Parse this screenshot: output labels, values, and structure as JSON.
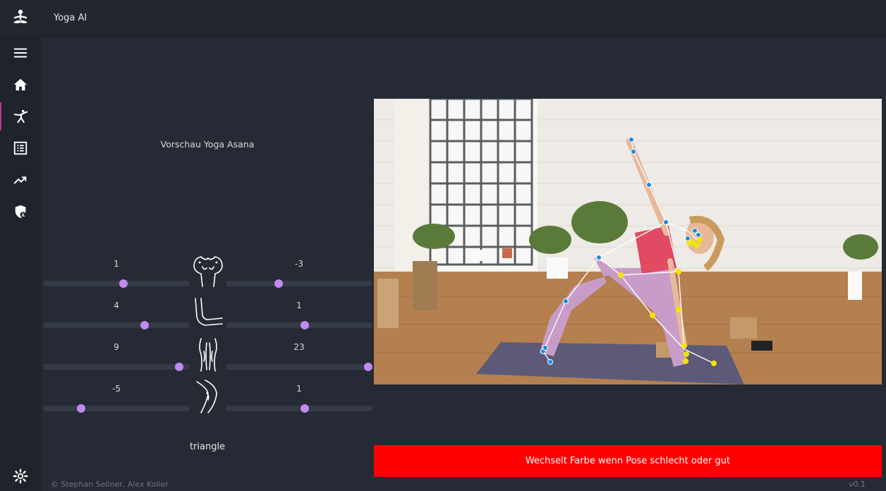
{
  "app": {
    "title": "Yoga AI"
  },
  "sidebar": {
    "items": [
      {
        "icon": "menu-icon"
      },
      {
        "icon": "home-icon"
      },
      {
        "icon": "yoga-pose-icon",
        "active": true
      },
      {
        "icon": "list-icon"
      },
      {
        "icon": "trending-up-icon"
      },
      {
        "icon": "shield-user-icon"
      },
      {
        "icon": "gear-icon"
      }
    ]
  },
  "preview": {
    "label": "Vorschau Yoga Asana",
    "pose_name": "triangle"
  },
  "sliders": {
    "row1": {
      "left_value": "1",
      "right_value": "-3",
      "left_position": 0.55,
      "right_position": 0.36,
      "icon": "shoulders-icon"
    },
    "row2": {
      "left_value": "4",
      "right_value": "1",
      "left_position": 0.69,
      "right_position": 0.54,
      "icon": "elbow-icon"
    },
    "row3": {
      "left_value": "9",
      "right_value": "23",
      "left_position": 0.93,
      "right_position": 0.97,
      "icon": "legs-icon"
    },
    "row4": {
      "left_value": "-5",
      "right_value": "1",
      "left_position": 0.26,
      "right_position": 0.54,
      "icon": "knee-icon"
    }
  },
  "feedback": {
    "text": "Wechselt Farbe wenn Pose schlecht oder gut",
    "color": "#ff0000"
  },
  "footer": {
    "credits": "© Stephan Seliner, Alex Koller",
    "version": "v0.1"
  },
  "colors": {
    "accent": "#c08af0",
    "active_indicator": "#b23a8a",
    "background": "#262a34",
    "sidebar": "#1f232b"
  }
}
